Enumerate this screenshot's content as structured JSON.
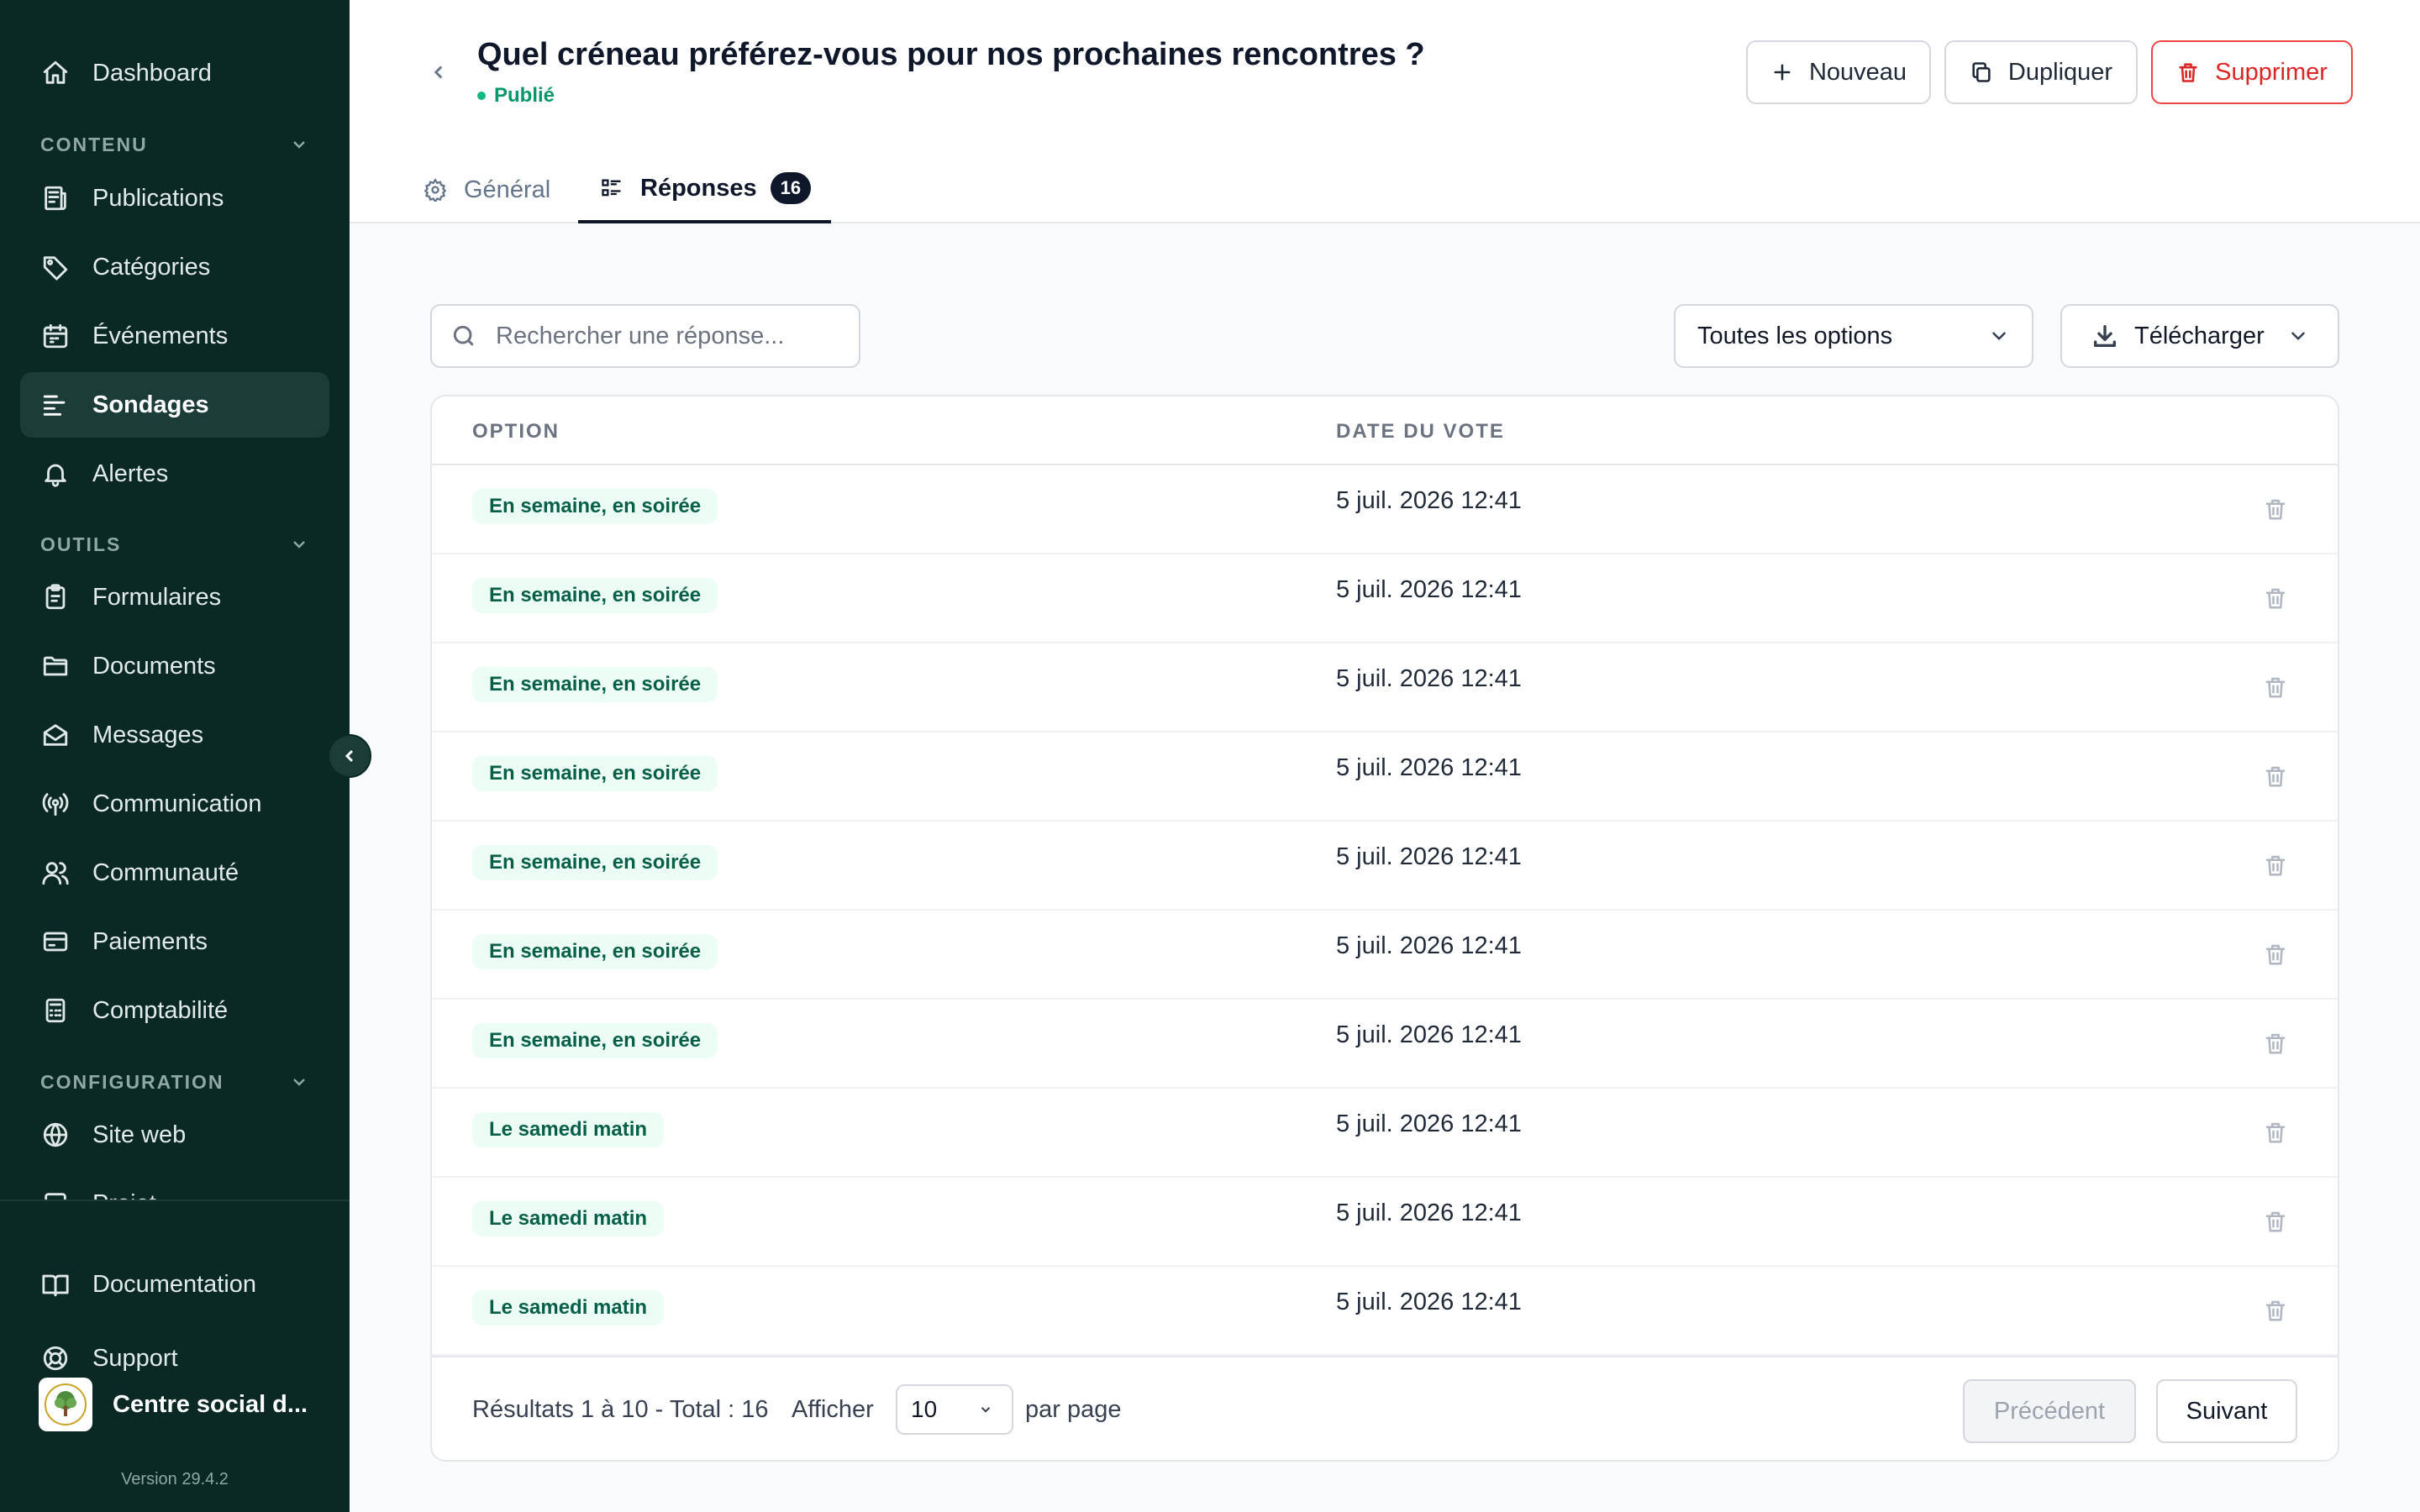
{
  "sidebar": {
    "dashboard": "Dashboard",
    "sections": {
      "contenu": "CONTENU",
      "outils": "OUTILS",
      "configuration": "CONFIGURATION"
    },
    "items": {
      "publications": "Publications",
      "categories": "Catégories",
      "evenements": "Événements",
      "sondages": "Sondages",
      "alertes": "Alertes",
      "formulaires": "Formulaires",
      "documents": "Documents",
      "messages": "Messages",
      "communication": "Communication",
      "communaute": "Communauté",
      "paiements": "Paiements",
      "comptabilite": "Comptabilité",
      "site_web": "Site web",
      "projet": "Projet"
    },
    "bottom": {
      "documentation": "Documentation",
      "support": "Support",
      "org_name": "Centre social d...",
      "version": "Version 29.4.2"
    }
  },
  "header": {
    "title": "Quel créneau préférez-vous pour nos prochaines rencontres ?",
    "status": "Publié",
    "buttons": {
      "new": "Nouveau",
      "duplicate": "Dupliquer",
      "delete": "Supprimer"
    },
    "tabs": {
      "general": "Général",
      "responses": "Réponses",
      "responses_count": "16"
    }
  },
  "toolbar": {
    "search_placeholder": "Rechercher une réponse...",
    "filter_value": "Toutes les options",
    "download": "Télécharger"
  },
  "table": {
    "columns": {
      "option": "OPTION",
      "date": "DATE DU VOTE"
    },
    "rows": [
      {
        "option": "En semaine, en soirée",
        "date": "5 juil. 2026 12:41"
      },
      {
        "option": "En semaine, en soirée",
        "date": "5 juil. 2026 12:41"
      },
      {
        "option": "En semaine, en soirée",
        "date": "5 juil. 2026 12:41"
      },
      {
        "option": "En semaine, en soirée",
        "date": "5 juil. 2026 12:41"
      },
      {
        "option": "En semaine, en soirée",
        "date": "5 juil. 2026 12:41"
      },
      {
        "option": "En semaine, en soirée",
        "date": "5 juil. 2026 12:41"
      },
      {
        "option": "En semaine, en soirée",
        "date": "5 juil. 2026 12:41"
      },
      {
        "option": "Le samedi matin",
        "date": "5 juil. 2026 12:41"
      },
      {
        "option": "Le samedi matin",
        "date": "5 juil. 2026 12:41"
      },
      {
        "option": "Le samedi matin",
        "date": "5 juil. 2026 12:41"
      }
    ]
  },
  "pagination": {
    "results": "Résultats 1 à 10 - Total : 16",
    "show": "Afficher",
    "per_page_value": "10",
    "per_page": "par page",
    "previous": "Précédent",
    "next": "Suivant"
  }
}
